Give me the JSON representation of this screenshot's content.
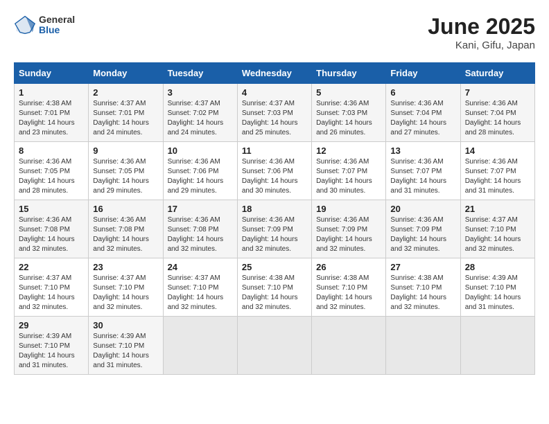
{
  "logo": {
    "general": "General",
    "blue": "Blue"
  },
  "title": "June 2025",
  "subtitle": "Kani, Gifu, Japan",
  "days_of_week": [
    "Sunday",
    "Monday",
    "Tuesday",
    "Wednesday",
    "Thursday",
    "Friday",
    "Saturday"
  ],
  "weeks": [
    [
      {
        "day": "1",
        "sunrise": "4:38 AM",
        "sunset": "7:01 PM",
        "daylight": "14 hours and 23 minutes."
      },
      {
        "day": "2",
        "sunrise": "4:37 AM",
        "sunset": "7:01 PM",
        "daylight": "14 hours and 24 minutes."
      },
      {
        "day": "3",
        "sunrise": "4:37 AM",
        "sunset": "7:02 PM",
        "daylight": "14 hours and 24 minutes."
      },
      {
        "day": "4",
        "sunrise": "4:37 AM",
        "sunset": "7:03 PM",
        "daylight": "14 hours and 25 minutes."
      },
      {
        "day": "5",
        "sunrise": "4:36 AM",
        "sunset": "7:03 PM",
        "daylight": "14 hours and 26 minutes."
      },
      {
        "day": "6",
        "sunrise": "4:36 AM",
        "sunset": "7:04 PM",
        "daylight": "14 hours and 27 minutes."
      },
      {
        "day": "7",
        "sunrise": "4:36 AM",
        "sunset": "7:04 PM",
        "daylight": "14 hours and 28 minutes."
      }
    ],
    [
      {
        "day": "8",
        "sunrise": "4:36 AM",
        "sunset": "7:05 PM",
        "daylight": "14 hours and 28 minutes."
      },
      {
        "day": "9",
        "sunrise": "4:36 AM",
        "sunset": "7:05 PM",
        "daylight": "14 hours and 29 minutes."
      },
      {
        "day": "10",
        "sunrise": "4:36 AM",
        "sunset": "7:06 PM",
        "daylight": "14 hours and 29 minutes."
      },
      {
        "day": "11",
        "sunrise": "4:36 AM",
        "sunset": "7:06 PM",
        "daylight": "14 hours and 30 minutes."
      },
      {
        "day": "12",
        "sunrise": "4:36 AM",
        "sunset": "7:07 PM",
        "daylight": "14 hours and 30 minutes."
      },
      {
        "day": "13",
        "sunrise": "4:36 AM",
        "sunset": "7:07 PM",
        "daylight": "14 hours and 31 minutes."
      },
      {
        "day": "14",
        "sunrise": "4:36 AM",
        "sunset": "7:07 PM",
        "daylight": "14 hours and 31 minutes."
      }
    ],
    [
      {
        "day": "15",
        "sunrise": "4:36 AM",
        "sunset": "7:08 PM",
        "daylight": "14 hours and 32 minutes."
      },
      {
        "day": "16",
        "sunrise": "4:36 AM",
        "sunset": "7:08 PM",
        "daylight": "14 hours and 32 minutes."
      },
      {
        "day": "17",
        "sunrise": "4:36 AM",
        "sunset": "7:08 PM",
        "daylight": "14 hours and 32 minutes."
      },
      {
        "day": "18",
        "sunrise": "4:36 AM",
        "sunset": "7:09 PM",
        "daylight": "14 hours and 32 minutes."
      },
      {
        "day": "19",
        "sunrise": "4:36 AM",
        "sunset": "7:09 PM",
        "daylight": "14 hours and 32 minutes."
      },
      {
        "day": "20",
        "sunrise": "4:36 AM",
        "sunset": "7:09 PM",
        "daylight": "14 hours and 32 minutes."
      },
      {
        "day": "21",
        "sunrise": "4:37 AM",
        "sunset": "7:10 PM",
        "daylight": "14 hours and 32 minutes."
      }
    ],
    [
      {
        "day": "22",
        "sunrise": "4:37 AM",
        "sunset": "7:10 PM",
        "daylight": "14 hours and 32 minutes."
      },
      {
        "day": "23",
        "sunrise": "4:37 AM",
        "sunset": "7:10 PM",
        "daylight": "14 hours and 32 minutes."
      },
      {
        "day": "24",
        "sunrise": "4:37 AM",
        "sunset": "7:10 PM",
        "daylight": "14 hours and 32 minutes."
      },
      {
        "day": "25",
        "sunrise": "4:38 AM",
        "sunset": "7:10 PM",
        "daylight": "14 hours and 32 minutes."
      },
      {
        "day": "26",
        "sunrise": "4:38 AM",
        "sunset": "7:10 PM",
        "daylight": "14 hours and 32 minutes."
      },
      {
        "day": "27",
        "sunrise": "4:38 AM",
        "sunset": "7:10 PM",
        "daylight": "14 hours and 32 minutes."
      },
      {
        "day": "28",
        "sunrise": "4:39 AM",
        "sunset": "7:10 PM",
        "daylight": "14 hours and 31 minutes."
      }
    ],
    [
      {
        "day": "29",
        "sunrise": "4:39 AM",
        "sunset": "7:10 PM",
        "daylight": "14 hours and 31 minutes."
      },
      {
        "day": "30",
        "sunrise": "4:39 AM",
        "sunset": "7:10 PM",
        "daylight": "14 hours and 31 minutes."
      },
      null,
      null,
      null,
      null,
      null
    ]
  ],
  "labels": {
    "sunrise": "Sunrise: ",
    "sunset": "Sunset: ",
    "daylight": "Daylight: "
  }
}
